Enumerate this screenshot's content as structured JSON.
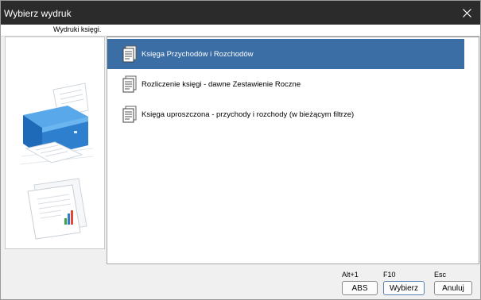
{
  "window": {
    "title": "Wybierz wydruk"
  },
  "header": {
    "label": "Wydruki księgi."
  },
  "list": {
    "items": [
      {
        "label": "Księga Przychodów i Rozchodów",
        "selected": true
      },
      {
        "label": "Rozliczenie księgi - dawne Zestawienie Roczne",
        "selected": false
      },
      {
        "label": "Księga uproszczona - przychody i rozchody (w bieżącym filtrze)",
        "selected": false
      }
    ]
  },
  "footer": {
    "buttons": [
      {
        "hotkey": "Alt+1",
        "label": "ABS"
      },
      {
        "hotkey": "F10",
        "label": "Wybierz"
      },
      {
        "hotkey": "Esc",
        "label": "Anuluj"
      }
    ]
  },
  "colors": {
    "titlebar": "#2b2b2b",
    "selection": "#3b6ea5",
    "printer_blue": "#2f7fcf"
  }
}
